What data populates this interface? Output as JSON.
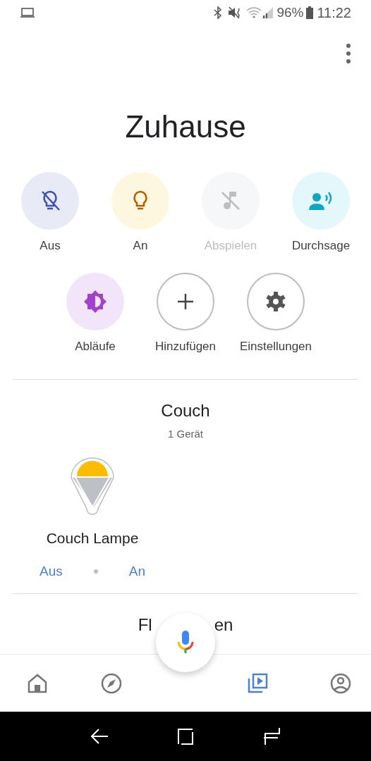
{
  "status_bar": {
    "battery": "96%",
    "time": "11:22"
  },
  "title": "Zuhause",
  "actions": [
    {
      "label": "Aus",
      "disabled": false
    },
    {
      "label": "An",
      "disabled": false
    },
    {
      "label": "Abspielen",
      "disabled": true
    },
    {
      "label": "Durchsage",
      "disabled": false
    },
    {
      "label": "Abläufe",
      "disabled": false
    },
    {
      "label": "Hinzufügen",
      "disabled": false
    },
    {
      "label": "Einstellungen",
      "disabled": false
    }
  ],
  "rooms": [
    {
      "name": "Couch",
      "count": "1 Gerät",
      "devices": [
        {
          "name": "Couch Lampe",
          "off_label": "Aus",
          "on_label": "An"
        }
      ]
    }
  ],
  "next_room": {
    "title_start": "Fl",
    "title_end": "en"
  },
  "bottom_nav": [
    {
      "selected": false
    },
    {
      "selected": false
    },
    {
      "selected": true
    },
    {
      "selected": false
    }
  ]
}
